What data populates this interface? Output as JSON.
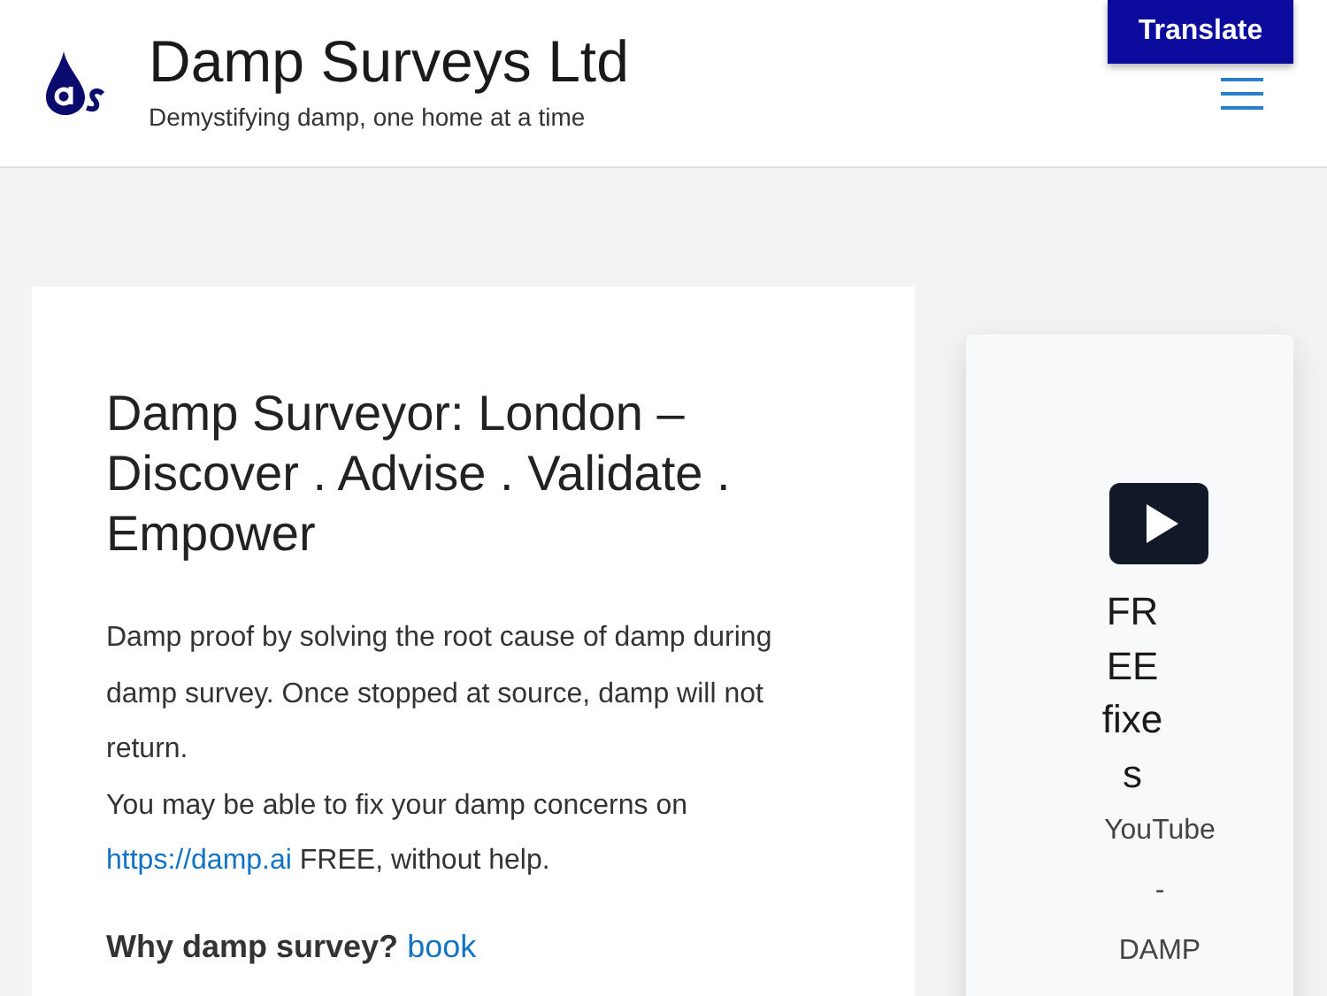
{
  "header": {
    "site_title": "Damp Surveys Ltd",
    "tagline": "Demystifying damp, one home at a time",
    "translate_button": "Translate"
  },
  "article": {
    "title": "Damp Surveyor: London – Discover . Advise . Validate . Empower",
    "paragraph": "Damp proof by solving the root cause of damp during damp survey. Once stopped at source, damp will not return.",
    "note": {
      "before": "You may be able to fix your damp concerns on",
      "link": "https://damp.ai",
      "after": " FREE, without help."
    },
    "subheading": {
      "text": "Why damp survey?",
      "link": "book"
    }
  },
  "sidebar": {
    "video_title": "FREE fixes",
    "lines": [
      "YouTube",
      "-",
      "DAMP"
    ]
  }
}
